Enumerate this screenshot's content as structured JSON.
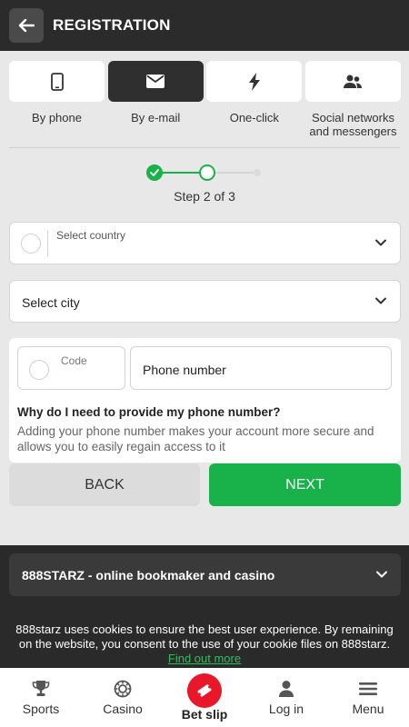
{
  "header": {
    "title": "REGISTRATION",
    "back_icon": "arrow-left-icon"
  },
  "tabs": [
    {
      "label": "By phone",
      "icon": "phone-icon",
      "active": false
    },
    {
      "label": "By e-mail",
      "icon": "envelope-icon",
      "active": true
    },
    {
      "label": "One-click",
      "icon": "lightning-icon",
      "active": false
    },
    {
      "label": "Social networks and messengers",
      "icon": "users-icon",
      "active": false
    }
  ],
  "stepper": {
    "current": 2,
    "total": 3,
    "text": "Step 2 of 3"
  },
  "form": {
    "country_label": "Select country",
    "city_label": "Select city",
    "code_label": "Code",
    "phone_placeholder": "Phone number",
    "why_title": "Why do I need to provide my phone number?",
    "why_text": "Adding your phone number makes your account more secure and allows you to easily regain access to it"
  },
  "buttons": {
    "back_label": "BACK",
    "next_label": "NEXT"
  },
  "footer": {
    "accordion_label": "888STARZ - online bookmaker and casino",
    "cookie_text": "888starz uses cookies to ensure the best user experience. By remaining on the website, you consent to the use of your cookie files on 888starz.",
    "cookie_link": "Find out more"
  },
  "bottom_nav": [
    {
      "label": "Sports",
      "icon": "trophy-icon"
    },
    {
      "label": "Casino",
      "icon": "casino-chip-icon"
    },
    {
      "label": "Bet slip",
      "icon": "ticket-icon"
    },
    {
      "label": "Log in",
      "icon": "user-icon"
    },
    {
      "label": "Menu",
      "icon": "hamburger-icon"
    }
  ],
  "colors": {
    "accent_green": "#19b24a",
    "header_bg": "#2b2b2b",
    "betslip_red": "#e8182a",
    "page_bg": "#e8e8e8"
  }
}
